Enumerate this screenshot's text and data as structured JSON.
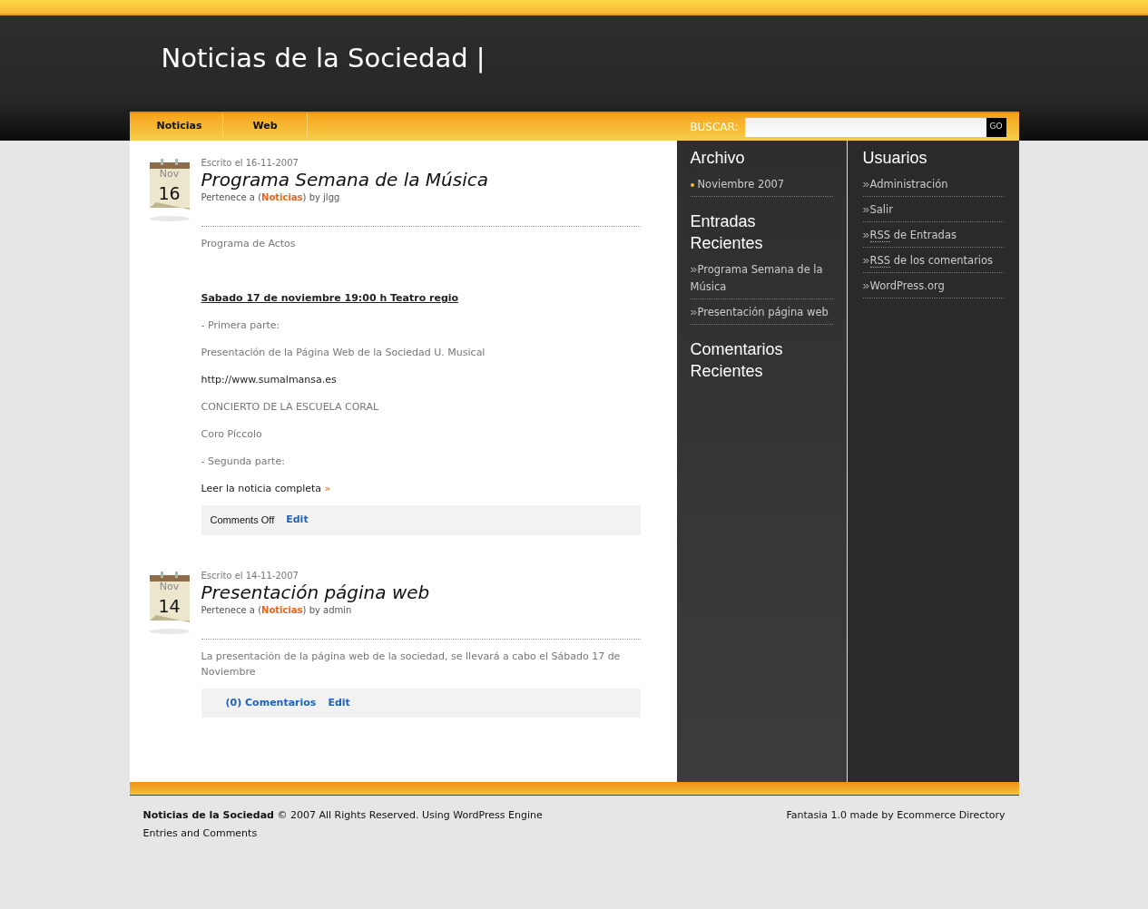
{
  "site_title": "Noticias de la Sociedad |",
  "nav": {
    "items": [
      {
        "label": "Noticias"
      },
      {
        "label": "Web"
      }
    ]
  },
  "search": {
    "label": "BUSCAR:",
    "button": "GO"
  },
  "posts": [
    {
      "month": "Nov",
      "day": "16",
      "written": "Escrito el 16-11-2007",
      "title": "Programa Semana de la Música",
      "meta_prefix": "Pertenece a (",
      "category": "Noticias",
      "meta_suffix": ") by jlgg",
      "body": [
        {
          "kind": "text",
          "text": "Programa de Actos"
        },
        {
          "kind": "spacer"
        },
        {
          "kind": "heading",
          "text": "Sabado 17 de noviembre 19:00 h Teatro regio"
        },
        {
          "kind": "text",
          "text": "- Primera parte:"
        },
        {
          "kind": "text",
          "text": "Presentación de la Página Web de la Sociedad U. Musical"
        },
        {
          "kind": "link",
          "text": "http://www.sumalmansa.es"
        },
        {
          "kind": "text",
          "text": "CONCIERTO DE LA ESCUELA CORAL"
        },
        {
          "kind": "text",
          "text": "Coro Píccolo"
        },
        {
          "kind": "text",
          "text": "- Segunda parte:"
        },
        {
          "kind": "more",
          "text": "Leer la noticia completa",
          "mark": "»"
        }
      ],
      "footer": [
        {
          "kind": "text",
          "text": "Comments Off"
        },
        {
          "kind": "link",
          "text": "Edit"
        }
      ]
    },
    {
      "month": "Nov",
      "day": "14",
      "written": "Escrito el 14-11-2007",
      "title": "Presentación página web",
      "meta_prefix": "Pertenece a (",
      "category": "Noticias",
      "meta_suffix": ") by admin",
      "body": [
        {
          "kind": "text",
          "text": "La presentación de la página web de la sociedad, se llevará a cabo el Sábado 17 de Noviembre"
        }
      ],
      "footer": [
        {
          "kind": "link",
          "text": "(0) Comentarios"
        },
        {
          "kind": "link",
          "text": "Edit"
        }
      ]
    }
  ],
  "sidebar_1": [
    {
      "title": "Archivo",
      "kind": "dot",
      "items": [
        {
          "text": "Noviembre 2007"
        }
      ]
    },
    {
      "title": "Entradas Recientes",
      "kind": "chevron",
      "items": [
        {
          "text": "Programa Semana de la Música"
        },
        {
          "text": "Presentación página web"
        }
      ]
    },
    {
      "title": "Comentarios Recientes"
    }
  ],
  "sidebar_2": [
    {
      "title": "Usuarios",
      "kind": "chevron",
      "items": [
        {
          "text": "Administración"
        },
        {
          "text": "Salir"
        },
        {
          "abbr": "RSS",
          "text": "de Entradas"
        },
        {
          "abbr": "RSS",
          "text": "de los comentarios"
        },
        {
          "text": "WordPress.org"
        }
      ]
    }
  ],
  "footer": {
    "left": [
      "**Noticias de la Sociedad** © 2007 All Rights Reserved. Using WordPress Engine",
      "Entries and Comments"
    ],
    "right": "Fantasia 1.0 made by Ecommerce Directory"
  }
}
